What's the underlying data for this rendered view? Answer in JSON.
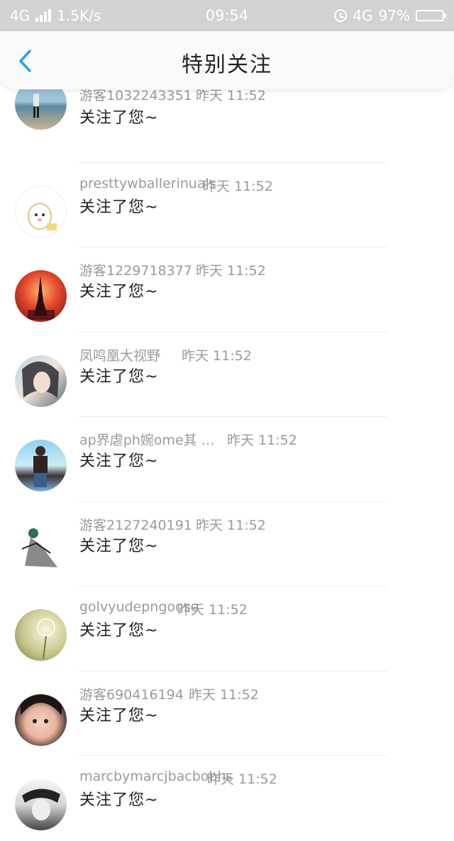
{
  "status_bar": {
    "network": "4G",
    "speed": "1.5K/s",
    "time": "09:54",
    "network_right": "4G",
    "battery": "97%"
  },
  "header": {
    "title": "特别关注",
    "accent_color": "#2a9df4"
  },
  "items": [
    {
      "name": "游客1032243351",
      "time": "昨天 11:52",
      "message": "关注了您~",
      "avatar": "beach-photo"
    },
    {
      "name": "presttywballerinuals",
      "time": "昨天 11:52",
      "message": "关注了您~",
      "avatar": "cartoon-egg"
    },
    {
      "name": "游客1229718377",
      "time": "昨天 11:52",
      "message": "关注了您~",
      "avatar": "eiffel-sunset"
    },
    {
      "name": "凤鸣凰大视野",
      "time": "昨天 11:52",
      "message": "关注了您~",
      "avatar": "girl-portrait"
    },
    {
      "name": "ap界虐ph婉ome其 …",
      "time": "昨天 11:52",
      "message": "关注了您~",
      "avatar": "girl-standing"
    },
    {
      "name": "游客2127240191",
      "time": "昨天 11:52",
      "message": "关注了您~",
      "avatar": "dancer-figure"
    },
    {
      "name": "golvyudepngoose",
      "time": "昨天 11:52",
      "message": "关注了您~",
      "avatar": "dandelion"
    },
    {
      "name": "游客690416194",
      "time": "昨天 11:52",
      "message": "关注了您~",
      "avatar": "child-portrait"
    },
    {
      "name": "marcbymarcjbacbobhs",
      "time": "昨天 11:52",
      "message": "关注了您~",
      "avatar": "boy-bw"
    }
  ]
}
